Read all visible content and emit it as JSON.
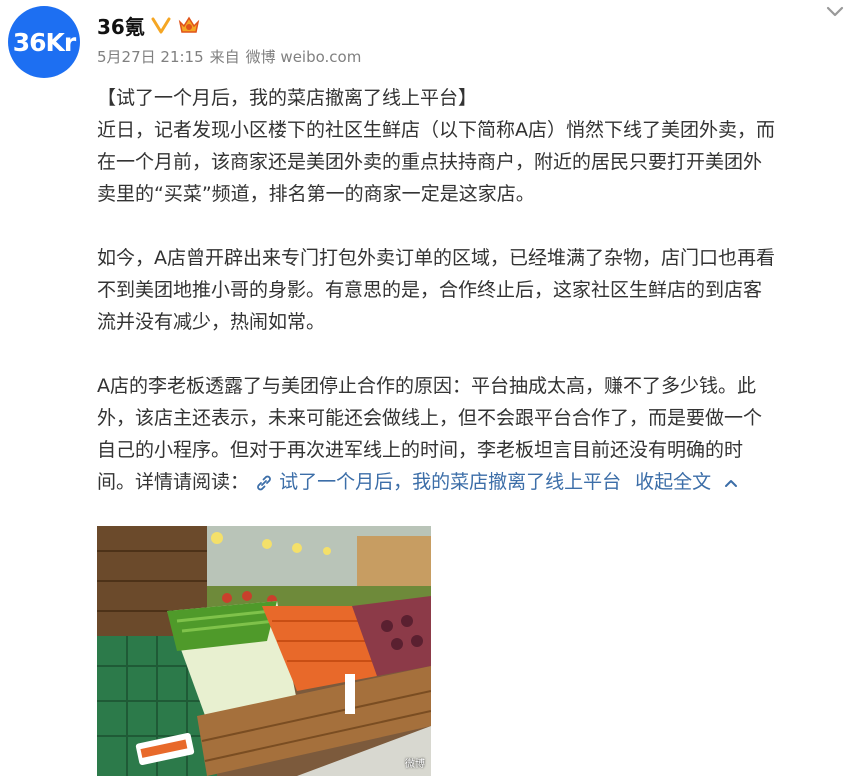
{
  "author": {
    "avatar_text": "36Kr",
    "name": "36氪"
  },
  "meta": {
    "date": "5月27日 21:15",
    "source_prefix": "来自",
    "source": "微博 weibo.com"
  },
  "post": {
    "title": "【试了一个月后，我的菜店撤离了线上平台】",
    "para1": [
      "近日，记者发现小区楼下的社区生鲜店（以下简称A店）悄然下线了美团外卖，而",
      "在一个月前，该商家还是美团外卖的重点扶持商户，附近的居民只要打开美团外",
      "卖里的“买菜”频道，排名第一的商家一定是这家店。"
    ],
    "para2": [
      "如今，A店曾开辟出来专门打包外卖订单的区域，已经堆满了杂物，店门口也再看",
      "不到美团地推小哥的身影。有意思的是，合作终止后，这家社区生鲜店的到店客",
      "流并没有减少，热闹如常。"
    ],
    "para3": [
      "A店的李老板透露了与美团停止合作的原因：平台抽成太高，赚不了多少钱。此",
      "外，该店主还表示，未来可能还会做线上，但不会跟平台合作了，而是要做一个",
      "自己的小程序。但对于再次进军线上的时间，李老板坦言目前还没有明确的时"
    ],
    "para3_last": "间。详情请阅读：",
    "link_text": "试了一个月后，我的菜店撤离了线上平台",
    "collapse_label": "收起全文"
  },
  "image": {
    "watermark": "微博"
  },
  "colors": {
    "link": "#3c6ea8",
    "avatar_bg": "#1d6ff2",
    "verified": "#f5a623"
  },
  "icons": [
    "verified-icon",
    "vip-crown-icon",
    "chevron-down-icon",
    "link-icon",
    "chevron-up-icon"
  ]
}
